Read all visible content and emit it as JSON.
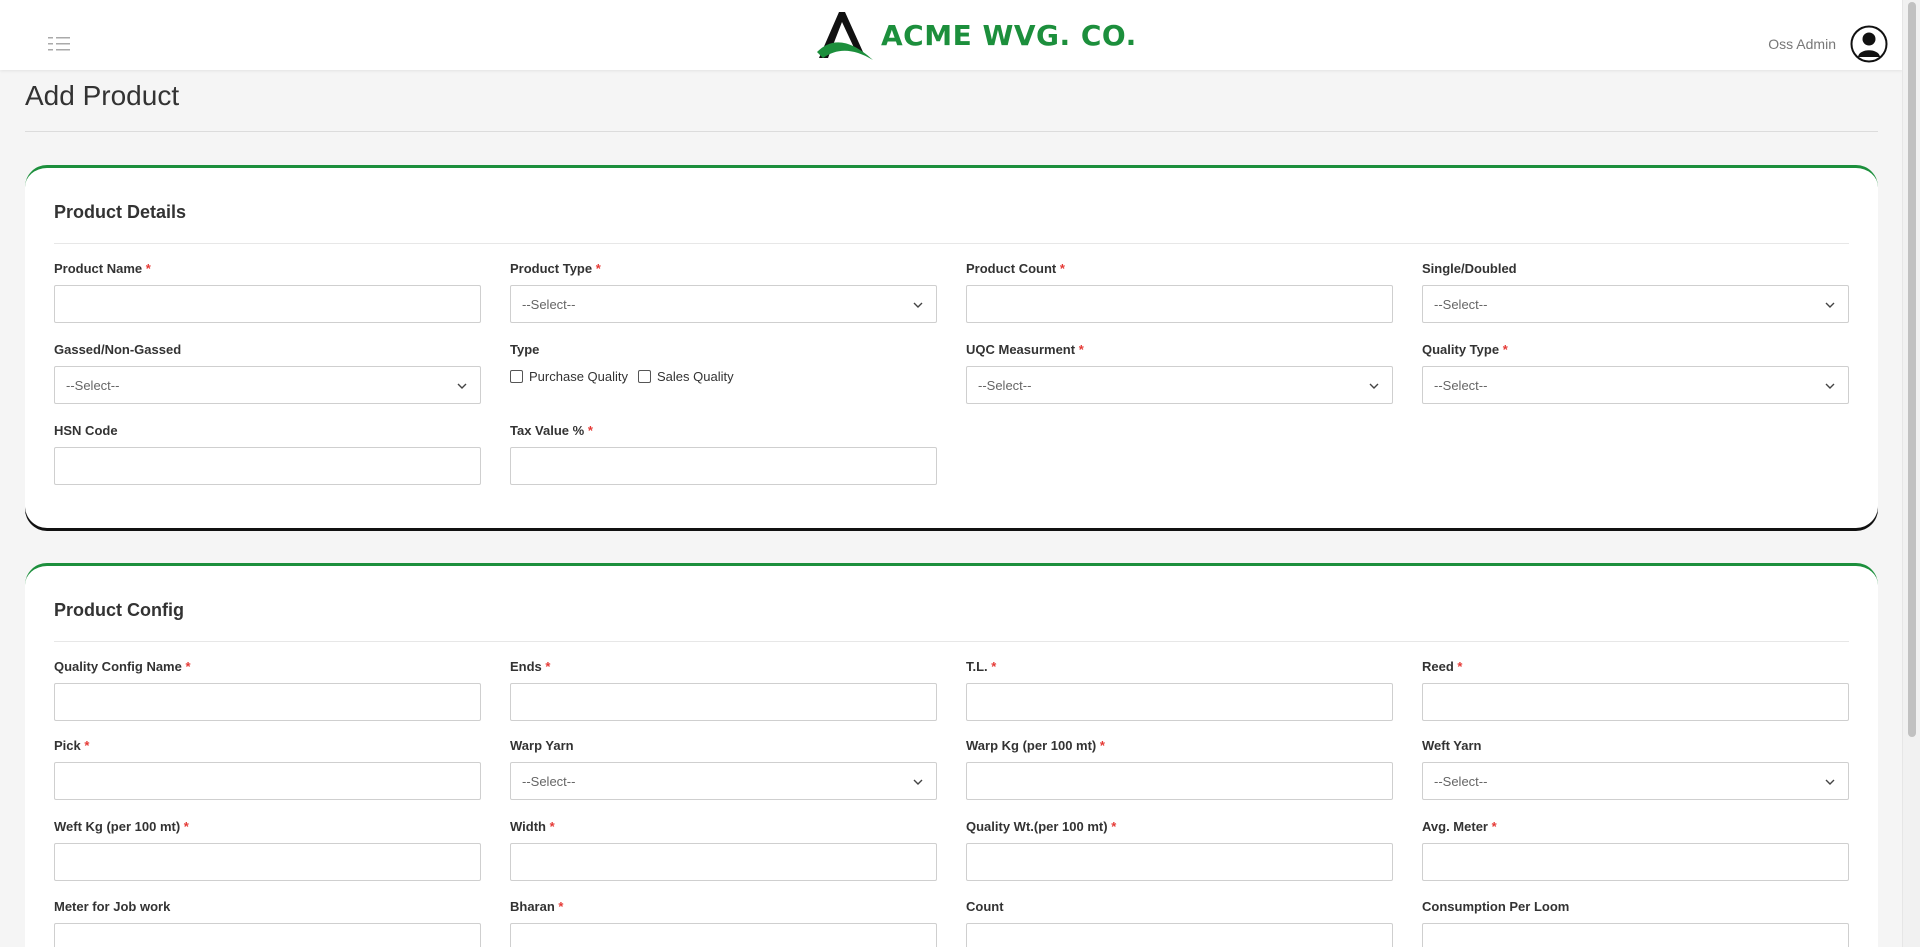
{
  "header": {
    "brand": "ACME WVG. CO.",
    "user_name": "Oss Admin",
    "colors": {
      "brand": "#1c8f3c",
      "required": "#e53935"
    }
  },
  "page": {
    "title": "Add Product"
  },
  "product_details": {
    "title": "Product Details",
    "fields": {
      "product_name": {
        "label": "Product Name",
        "required": "*",
        "value": ""
      },
      "product_type": {
        "label": "Product Type",
        "required": "*",
        "value": "--Select--"
      },
      "product_count": {
        "label": "Product Count",
        "required": "*",
        "value": ""
      },
      "single_doubled": {
        "label": "Single/Doubled",
        "value": "--Select--"
      },
      "gassed": {
        "label": "Gassed/Non-Gassed",
        "value": "--Select--"
      },
      "type": {
        "label": "Type",
        "options": [
          "Purchase Quality",
          "Sales Quality"
        ]
      },
      "uqc": {
        "label": "UQC Measurment",
        "required": "*",
        "value": "--Select--"
      },
      "quality_type": {
        "label": "Quality Type",
        "required": "*",
        "value": "--Select--"
      },
      "hsn_code": {
        "label": "HSN Code",
        "value": ""
      },
      "tax_value": {
        "label": "Tax Value %",
        "required": "*",
        "value": ""
      }
    }
  },
  "product_config": {
    "title": "Product Config",
    "fields": {
      "quality_config_name": {
        "label": "Quality Config Name",
        "required": "*"
      },
      "ends": {
        "label": "Ends",
        "required": "*"
      },
      "tl": {
        "label": "T.L.",
        "required": "*"
      },
      "reed": {
        "label": "Reed",
        "required": "*"
      },
      "pick": {
        "label": "Pick",
        "required": "*"
      },
      "warp_yarn": {
        "label": "Warp Yarn",
        "value": "--Select--"
      },
      "warp_kg": {
        "label": "Warp Kg (per 100 mt)",
        "required": "*"
      },
      "weft_yarn": {
        "label": "Weft Yarn",
        "value": "--Select--"
      },
      "weft_kg": {
        "label": "Weft Kg (per 100 mt)",
        "required": "*"
      },
      "width": {
        "label": "Width",
        "required": "*"
      },
      "quality_wt": {
        "label": "Quality Wt.(per 100 mt)",
        "required": "*"
      },
      "avg_meter": {
        "label": "Avg. Meter",
        "required": "*"
      },
      "meter_job_work": {
        "label": "Meter for Job work"
      },
      "bharan": {
        "label": "Bharan",
        "required": "*"
      },
      "count": {
        "label": "Count"
      },
      "consumption_per_loom": {
        "label": "Consumption Per Loom"
      }
    }
  }
}
